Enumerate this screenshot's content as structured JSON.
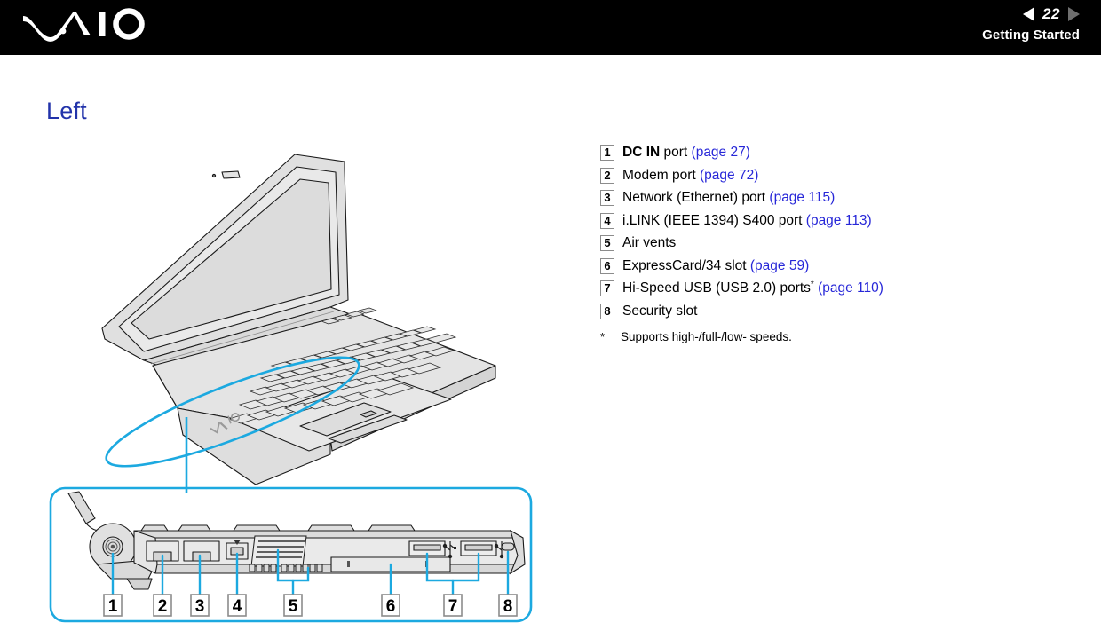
{
  "header": {
    "logo_name": "vaio-logo",
    "page_number": "22",
    "prev_arrow": "◀",
    "next_arrow": "▶",
    "section_title": "Getting Started"
  },
  "page": {
    "heading": "Left"
  },
  "spec_list": {
    "items": [
      {
        "num": "1",
        "label_bold": "DC IN",
        "label_rest": " port ",
        "page_ref": "(page 27)",
        "star": ""
      },
      {
        "num": "2",
        "label_bold": "",
        "label_rest": "Modem port ",
        "page_ref": "(page 72)",
        "star": ""
      },
      {
        "num": "3",
        "label_bold": "",
        "label_rest": "Network (Ethernet) port ",
        "page_ref": "(page 115)",
        "star": ""
      },
      {
        "num": "4",
        "label_bold": "",
        "label_rest": "i.LINK (IEEE 1394) S400 port ",
        "page_ref": "(page 113)",
        "star": ""
      },
      {
        "num": "5",
        "label_bold": "",
        "label_rest": "Air vents",
        "page_ref": "",
        "star": ""
      },
      {
        "num": "6",
        "label_bold": "",
        "label_rest": "ExpressCard/34 slot ",
        "page_ref": "(page 59)",
        "star": ""
      },
      {
        "num": "7",
        "label_bold": "",
        "label_rest": "Hi-Speed USB (USB 2.0) ports",
        "page_ref": "(page 110)",
        "star": "*"
      },
      {
        "num": "8",
        "label_bold": "",
        "label_rest": "Security slot",
        "page_ref": "",
        "star": ""
      }
    ],
    "footnote_mark": "*",
    "footnote_text": "Supports high-/full-/low- speeds."
  },
  "illustration": {
    "top_caption": "open-laptop-left-side-view",
    "bottom_caption": "left-side-port-detail",
    "callouts": [
      "1",
      "2",
      "3",
      "4",
      "5",
      "6",
      "7",
      "8"
    ],
    "usb_icon_label": "usb-trident-icon"
  },
  "colors": {
    "heading_blue": "#2233aa",
    "link_blue": "#2727d8",
    "accent_cyan": "#1CA9E0",
    "header_black": "#000000",
    "line_art_gray": "#d9d9d9",
    "callout_border": "#8c8c8c"
  }
}
